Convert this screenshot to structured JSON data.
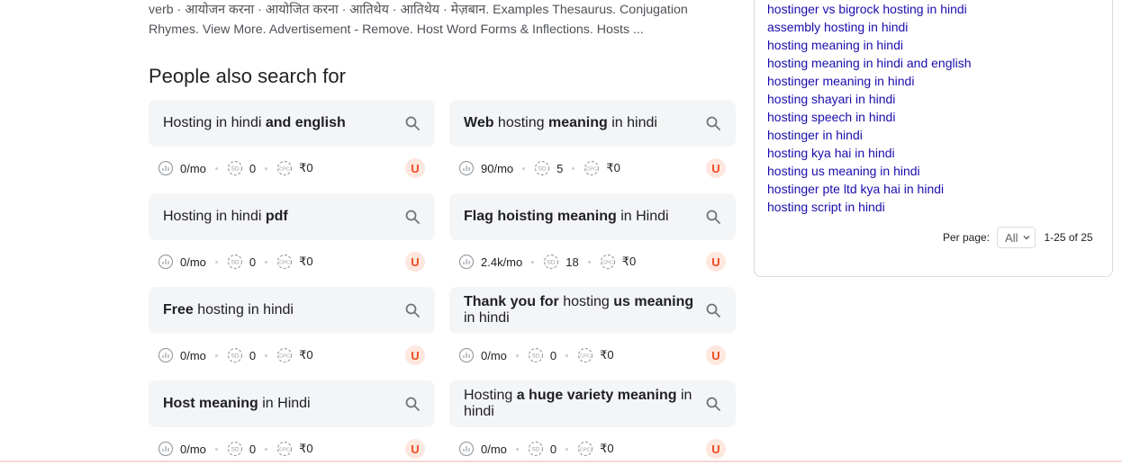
{
  "snippet": {
    "line1": "verb · आयोजन करना · आयोजित करना · आतिथेय · आतिथेय · मेज़बान. Examples Thesaurus. Conjugation",
    "line2": "Rhymes. View More. Advertisement - Remove. Host Word Forms & Inflections. Hosts ..."
  },
  "people_also_search": {
    "title": "People also search for",
    "items": [
      {
        "parts": [
          [
            "Hosting in hindi ",
            false
          ],
          [
            "and english",
            true
          ]
        ],
        "volume": "0/mo",
        "sd": "0",
        "cpc": "₹0",
        "badge": "U"
      },
      {
        "parts": [
          [
            "Web",
            true
          ],
          [
            " hosting ",
            false
          ],
          [
            "meaning",
            true
          ],
          [
            " in hindi",
            false
          ]
        ],
        "volume": "90/mo",
        "sd": "5",
        "cpc": "₹0",
        "badge": "U"
      },
      {
        "parts": [
          [
            "Hosting in hindi ",
            false
          ],
          [
            "pdf",
            true
          ]
        ],
        "volume": "0/mo",
        "sd": "0",
        "cpc": "₹0",
        "badge": "U"
      },
      {
        "parts": [
          [
            "Flag hoisting meaning",
            true
          ],
          [
            " in Hindi",
            false
          ]
        ],
        "volume": "2.4k/mo",
        "sd": "18",
        "cpc": "₹0",
        "badge": "U"
      },
      {
        "parts": [
          [
            "Free",
            true
          ],
          [
            " hosting in hindi",
            false
          ]
        ],
        "volume": "0/mo",
        "sd": "0",
        "cpc": "₹0",
        "badge": "U"
      },
      {
        "parts": [
          [
            "Thank you for",
            true
          ],
          [
            " hosting ",
            false
          ],
          [
            "us meaning",
            true
          ],
          [
            " in hindi",
            false
          ]
        ],
        "volume": "0/mo",
        "sd": "0",
        "cpc": "₹0",
        "badge": "U"
      },
      {
        "parts": [
          [
            "Host meaning",
            true
          ],
          [
            " in Hindi",
            false
          ]
        ],
        "volume": "0/mo",
        "sd": "0",
        "cpc": "₹0",
        "badge": "U"
      },
      {
        "parts": [
          [
            "Hosting ",
            false
          ],
          [
            "a huge variety meaning",
            true
          ],
          [
            " in hindi",
            false
          ]
        ],
        "volume": "0/mo",
        "sd": "0",
        "cpc": "₹0",
        "badge": "U"
      }
    ]
  },
  "related_keywords": [
    "hostinger vs bigrock hosting in hindi",
    "assembly hosting in hindi",
    "hosting meaning in hindi",
    "hosting meaning in hindi and english",
    "hostinger meaning in hindi",
    "hosting shayari in hindi",
    "hosting speech in hindi",
    "hostinger in hindi",
    "hosting kya hai in hindi",
    "hosting us meaning in hindi",
    "hostinger pte ltd kya hai in hindi",
    "hosting script in hindi"
  ],
  "pagination": {
    "per_page_label": "Per page:",
    "per_page_value": "All",
    "range": "1-25 of 25"
  },
  "colors": {
    "link": "#1a0dab",
    "chip_bg": "#f4f5f7",
    "badge_bg": "#fde7df",
    "badge_fg": "#ef4b21"
  }
}
